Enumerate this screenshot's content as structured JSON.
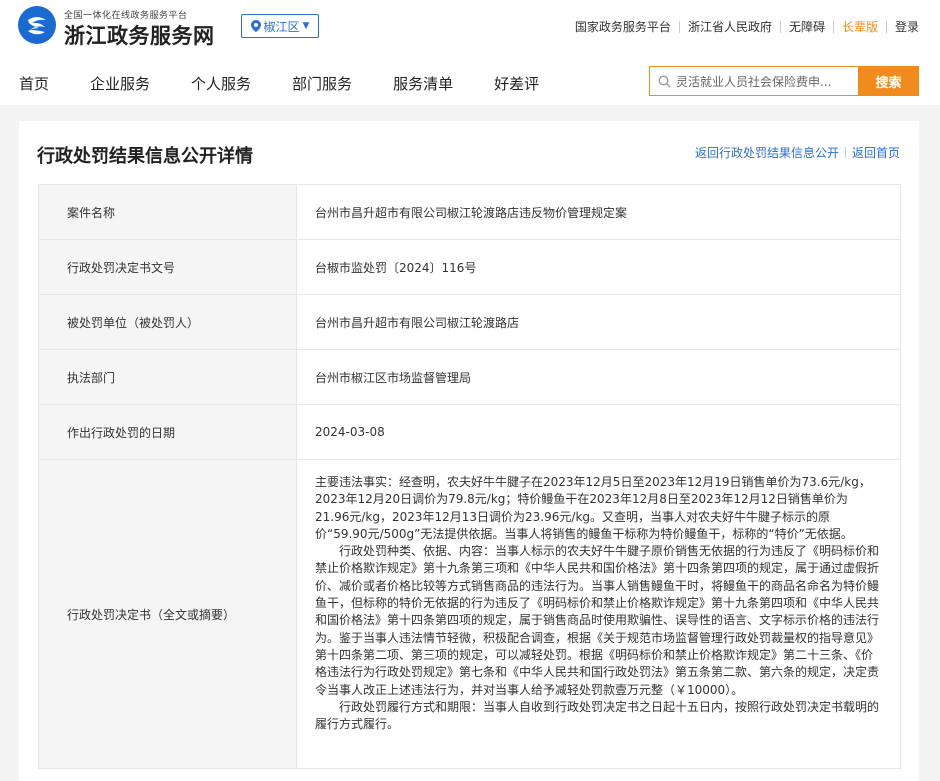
{
  "header": {
    "logo_subtitle": "全国一体化在线政务服务平台",
    "logo_title": "浙江政务服务网",
    "region": "椒江区",
    "top_links": [
      "国家政务服务平台",
      "浙江省人民政府",
      "无障碍",
      "长辈版",
      "登录"
    ],
    "active_top_link_index": 3,
    "nav": [
      "首页",
      "企业服务",
      "个人服务",
      "部门服务",
      "服务清单",
      "好差评"
    ],
    "search_value": "灵活就业人员社会保险费申...",
    "search_button": "搜索"
  },
  "page": {
    "title": "行政处罚结果信息公开详情",
    "links": [
      "返回行政处罚结果信息公开",
      "返回首页"
    ]
  },
  "table": {
    "rows": [
      {
        "label": "案件名称",
        "value": "台州市昌升超市有限公司椒江轮渡路店违反物价管理规定案"
      },
      {
        "label": "行政处罚决定书文号",
        "value": "台椒市监处罚〔2024〕116号"
      },
      {
        "label": "被处罚单位（被处罚人）",
        "value": "台州市昌升超市有限公司椒江轮渡路店"
      },
      {
        "label": "执法部门",
        "value": "台州市椒江区市场监督管理局"
      },
      {
        "label": "作出行政处罚的日期",
        "value": "2024-03-08"
      }
    ],
    "decision": {
      "label": "行政处罚决定书（全文或摘要）",
      "paragraphs": [
        "主要违法事实：经查明，农夫好牛牛腱子在2023年12月5日至2023年12月19日销售单价为73.6元/kg，2023年12月20日调价为79.8元/kg；特价鳗鱼干在2023年12月8日至2023年12月12日销售单价为21.96元/kg，2023年12月13日调价为23.96元/kg。又查明，当事人对农夫好牛牛腱子标示的原价“59.90元/500g”无法提供依据。当事人将销售的鳗鱼干标称为特价鳗鱼干，标称的“特价”无依据。",
        "行政处罚种类、依据、内容：当事人标示的农夫好牛牛腱子原价销售无依据的行为违反了《明码标价和禁止价格欺诈规定》第十九条第三项和《中华人民共和国价格法》第十四条第四项的规定，属于通过虚假折价、减价或者价格比较等方式销售商品的违法行为。当事人销售鳗鱼干时，将鳗鱼干的商品名命名为特价鳗鱼干，但标称的特价无依据的行为违反了《明码标价和禁止价格欺诈规定》第十九条第四项和《中华人民共和国价格法》第十四条第四项的规定，属于销售商品时使用欺骗性、误导性的语言、文字标示价格的违法行为。鉴于当事人违法情节轻微，积极配合调查，根据《关于规范市场监督管理行政处罚裁量权的指导意见》第十四条第二项、第三项的规定，可以减轻处罚。根据《明码标价和禁止价格欺诈规定》第二十三条、《价格违法行为行政处罚规定》第七条和《中华人民共和国行政处罚法》第五条第二款、第六条的规定，决定责令当事人改正上述违法行为，并对当事人给予减轻处罚款壹万元整（￥10000）。",
        "行政处罚履行方式和期限：当事人自收到行政处罚决定书之日起十五日内，按照行政处罚决定书载明的履行方式履行。"
      ]
    }
  },
  "colors": {
    "primary": "#2b6fcf",
    "accent": "#f08b1d",
    "logo": "#1a6ad0"
  }
}
